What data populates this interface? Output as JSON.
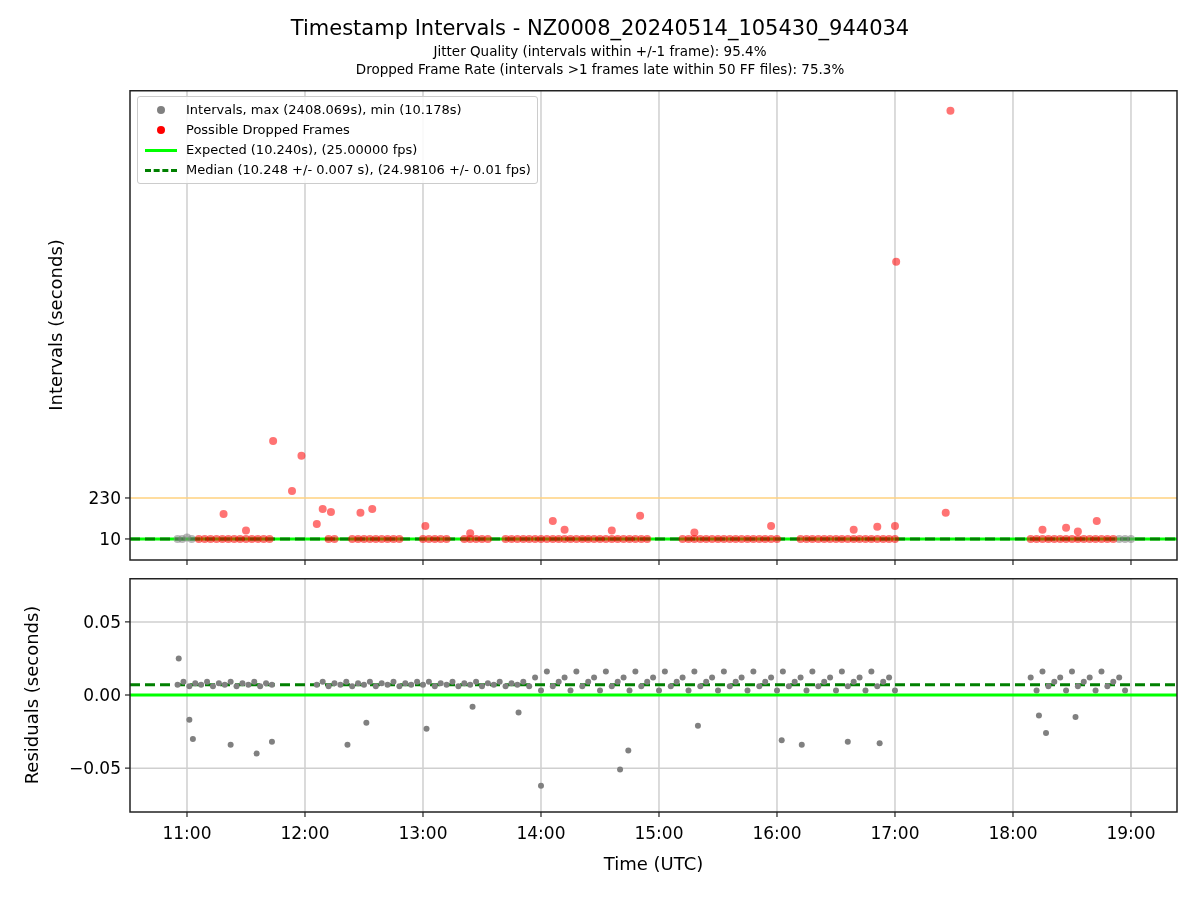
{
  "title": "Timestamp Intervals - NZ0008_20240514_105430_944034",
  "subtitles": [
    "Jitter Quality (intervals within +/-1 frame): 95.4%",
    "Dropped Frame Rate (intervals >1 frames late within 50 FF files): 75.3%"
  ],
  "charts": [
    {
      "chart_data": {
        "type": "scatter",
        "ylabel": "Intervals (seconds)",
        "xlim": [
          10.517,
          19.39
        ],
        "ylim": [
          -103,
          2420
        ],
        "grid": "x",
        "yticks": [
          {
            "value": 10,
            "label": "10"
          },
          {
            "value": 230,
            "label": "230"
          }
        ],
        "series": [
          {
            "name": "Intervals, max (2408.069s), min (10.178s)",
            "color": "#808080",
            "x": [
              10.92,
              10.96,
              11.0,
              11.04,
              18.9,
              18.95,
              19.0
            ],
            "values": [
              10,
              10,
              18,
              10,
              10,
              10,
              10
            ]
          },
          {
            "name": "Possible Dropped Frames",
            "color": "#ff0000",
            "x": [
              11.1,
              11.15,
              11.2,
              11.25,
              11.3,
              11.35,
              11.4,
              11.45,
              11.5,
              11.55,
              11.6,
              11.65,
              11.7,
              12.2,
              12.25,
              12.4,
              12.45,
              12.5,
              12.55,
              12.6,
              12.65,
              12.7,
              12.75,
              12.8,
              13.0,
              13.05,
              13.1,
              13.15,
              13.2,
              13.35,
              13.4,
              13.45,
              13.5,
              13.55,
              13.7,
              13.75,
              13.8,
              13.85,
              13.9,
              13.95,
              14.0,
              14.05,
              14.1,
              14.15,
              14.2,
              14.25,
              14.3,
              14.35,
              14.4,
              14.45,
              14.5,
              14.55,
              14.6,
              14.65,
              14.7,
              14.75,
              14.8,
              14.85,
              14.9,
              15.2,
              15.25,
              15.3,
              15.35,
              15.4,
              15.45,
              15.5,
              15.55,
              15.6,
              15.65,
              15.7,
              15.75,
              15.8,
              15.85,
              15.9,
              15.95,
              16.0,
              16.2,
              16.25,
              16.3,
              16.35,
              16.4,
              16.45,
              16.5,
              16.55,
              16.6,
              16.65,
              16.7,
              16.75,
              16.8,
              16.85,
              16.9,
              16.95,
              17.0,
              18.15,
              18.2,
              18.25,
              18.3,
              18.35,
              18.4,
              18.45,
              18.5,
              18.55,
              18.6,
              18.65,
              18.7,
              18.75,
              18.8,
              18.85,
              11.73,
              11.97,
              11.89,
              17.47,
              17.01,
              17.43,
              11.31,
              12.15,
              12.22,
              12.57,
              12.47,
              14.84,
              18.71,
              14.1,
              13.02,
              11.5,
              12.1,
              13.4,
              14.2,
              14.6,
              15.3,
              15.95,
              16.65,
              16.85,
              17.0,
              18.25,
              18.45,
              18.55
            ],
            "values": [
              10,
              10,
              10,
              10,
              10,
              10,
              10,
              10,
              10,
              10,
              10,
              10,
              10,
              10,
              10,
              10,
              10,
              10,
              10,
              10,
              10,
              10,
              10,
              10,
              10,
              10,
              10,
              10,
              10,
              10,
              10,
              10,
              10,
              10,
              10,
              10,
              10,
              10,
              10,
              10,
              10,
              10,
              10,
              10,
              10,
              10,
              10,
              10,
              10,
              10,
              10,
              10,
              10,
              10,
              10,
              10,
              10,
              10,
              10,
              10,
              10,
              10,
              10,
              10,
              10,
              10,
              10,
              10,
              10,
              10,
              10,
              10,
              10,
              10,
              10,
              10,
              10,
              10,
              10,
              10,
              10,
              10,
              10,
              10,
              10,
              10,
              10,
              10,
              10,
              10,
              10,
              10,
              10,
              10,
              10,
              10,
              10,
              10,
              10,
              10,
              10,
              10,
              10,
              10,
              10,
              10,
              10,
              10,
              536,
              456,
              268,
              2308,
              1498,
              150,
              144,
              171,
              155,
              171,
              150,
              134,
              107,
              107,
              80,
              55,
              90,
              40,
              60,
              55,
              45,
              80,
              60,
              75,
              80,
              60,
              70,
              50
            ]
          },
          {
            "type": "line",
            "color": "#ffd27f",
            "x": [
              10.517,
              19.39
            ],
            "values": [
              230,
              230
            ]
          },
          {
            "type": "line",
            "name": "Expected (10.240s), (25.00000 fps)",
            "color": "#00ff00",
            "x": [
              10.517,
              19.39
            ],
            "values": [
              10.24,
              10.24
            ]
          },
          {
            "type": "line",
            "line_style": "dashed",
            "name": "Median (10.248 +/- 0.007 s), (24.98106 +/- 0.01 fps)",
            "color": "#008000",
            "x": [
              10.517,
              19.39
            ],
            "values": [
              10.248,
              10.248
            ]
          }
        ],
        "legend": "upper left"
      }
    },
    {
      "chart_data": {
        "type": "scatter",
        "xlabel": "Time (UTC)",
        "ylabel": "Residuals (seconds)",
        "xlim": [
          10.517,
          19.39
        ],
        "ylim": [
          -0.08,
          0.08
        ],
        "xticks": [
          {
            "value": 11,
            "label": "11:00"
          },
          {
            "value": 12,
            "label": "12:00"
          },
          {
            "value": 13,
            "label": "13:00"
          },
          {
            "value": 14,
            "label": "14:00"
          },
          {
            "value": 15,
            "label": "15:00"
          },
          {
            "value": 16,
            "label": "16:00"
          },
          {
            "value": 17,
            "label": "17:00"
          },
          {
            "value": 18,
            "label": "18:00"
          },
          {
            "value": 19,
            "label": "19:00"
          }
        ],
        "yticks": [
          {
            "value": -0.05,
            "label": "−0.05"
          },
          {
            "value": 0,
            "label": "0.00"
          },
          {
            "value": 0.05,
            "label": "0.05"
          }
        ],
        "series": [
          {
            "type": "line",
            "color": "#00ff00",
            "x": [
              10.517,
              19.39
            ],
            "values": [
              0,
              0
            ]
          },
          {
            "type": "line",
            "line_style": "dashed",
            "color": "#008000",
            "x": [
              10.517,
              19.39
            ],
            "values": [
              0.007,
              0.007
            ]
          },
          {
            "color": "#808080",
            "x": [
              10.92,
              10.97,
              11.02,
              11.07,
              11.12,
              11.17,
              11.22,
              11.27,
              11.32,
              11.37,
              11.42,
              11.47,
              11.52,
              11.57,
              11.62,
              11.67,
              11.72,
              12.1,
              12.15,
              12.2,
              12.25,
              12.3,
              12.35,
              12.4,
              12.45,
              12.5,
              12.55,
              12.6,
              12.65,
              12.7,
              12.75,
              12.8,
              12.85,
              12.9,
              12.95,
              13.0,
              13.05,
              13.1,
              13.15,
              13.2,
              13.25,
              13.3,
              13.35,
              13.4,
              13.45,
              13.5,
              13.55,
              13.6,
              13.65,
              13.7,
              13.75,
              13.8,
              13.85,
              13.9,
              13.95,
              14.0,
              14.05,
              14.1,
              14.15,
              14.2,
              14.25,
              14.3,
              14.35,
              14.4,
              14.45,
              14.5,
              14.55,
              14.6,
              14.65,
              14.7,
              14.75,
              14.8,
              14.85,
              14.9,
              14.95,
              15.0,
              15.05,
              15.1,
              15.15,
              15.2,
              15.25,
              15.3,
              15.35,
              15.4,
              15.45,
              15.5,
              15.55,
              15.6,
              15.65,
              15.7,
              15.75,
              15.8,
              15.85,
              15.9,
              15.95,
              16.0,
              16.05,
              16.1,
              16.15,
              16.2,
              16.25,
              16.3,
              16.35,
              16.4,
              16.45,
              16.5,
              16.55,
              16.6,
              16.65,
              16.7,
              16.75,
              16.8,
              16.85,
              16.9,
              16.95,
              17.0,
              18.15,
              18.2,
              18.25,
              18.3,
              18.35,
              18.4,
              18.45,
              18.5,
              18.55,
              18.6,
              18.65,
              18.7,
              18.75,
              18.8,
              18.85,
              18.9,
              18.95,
              10.93,
              11.02,
              11.05,
              11.37,
              11.59,
              11.72,
              12.36,
              12.52,
              13.03,
              13.42,
              13.81,
              14.0,
              14.67,
              14.74,
              15.33,
              16.04,
              16.21,
              16.6,
              16.87,
              18.28,
              18.53,
              18.22
            ],
            "values": [
              0.007,
              0.009,
              0.006,
              0.008,
              0.007,
              0.009,
              0.006,
              0.008,
              0.007,
              0.009,
              0.006,
              0.008,
              0.007,
              0.009,
              0.006,
              0.008,
              0.007,
              0.007,
              0.009,
              0.006,
              0.008,
              0.007,
              0.009,
              0.006,
              0.008,
              0.007,
              0.009,
              0.006,
              0.008,
              0.007,
              0.009,
              0.006,
              0.008,
              0.007,
              0.009,
              0.007,
              0.009,
              0.006,
              0.008,
              0.007,
              0.009,
              0.006,
              0.008,
              0.007,
              0.009,
              0.006,
              0.008,
              0.007,
              0.009,
              0.006,
              0.008,
              0.007,
              0.009,
              0.006,
              0.012,
              0.003,
              0.016,
              0.006,
              0.009,
              0.012,
              0.003,
              0.016,
              0.006,
              0.009,
              0.012,
              0.003,
              0.016,
              0.006,
              0.009,
              0.012,
              0.003,
              0.016,
              0.006,
              0.009,
              0.012,
              0.003,
              0.016,
              0.006,
              0.009,
              0.012,
              0.003,
              0.016,
              0.006,
              0.009,
              0.012,
              0.003,
              0.016,
              0.006,
              0.009,
              0.012,
              0.003,
              0.016,
              0.006,
              0.009,
              0.012,
              0.003,
              0.016,
              0.006,
              0.009,
              0.012,
              0.003,
              0.016,
              0.006,
              0.009,
              0.012,
              0.003,
              0.016,
              0.006,
              0.009,
              0.012,
              0.003,
              0.016,
              0.006,
              0.009,
              0.012,
              0.003,
              0.012,
              0.003,
              0.016,
              0.006,
              0.009,
              0.012,
              0.003,
              0.016,
              0.006,
              0.009,
              0.012,
              0.003,
              0.016,
              0.006,
              0.009,
              0.012,
              0.003,
              0.025,
              -0.017,
              -0.03,
              -0.034,
              -0.04,
              -0.032,
              -0.034,
              -0.019,
              -0.023,
              -0.008,
              -0.012,
              -0.062,
              -0.051,
              -0.038,
              -0.021,
              -0.031,
              -0.034,
              -0.032,
              -0.033,
              -0.026,
              -0.015,
              -0.014
            ]
          }
        ],
        "grid": "both"
      }
    }
  ]
}
